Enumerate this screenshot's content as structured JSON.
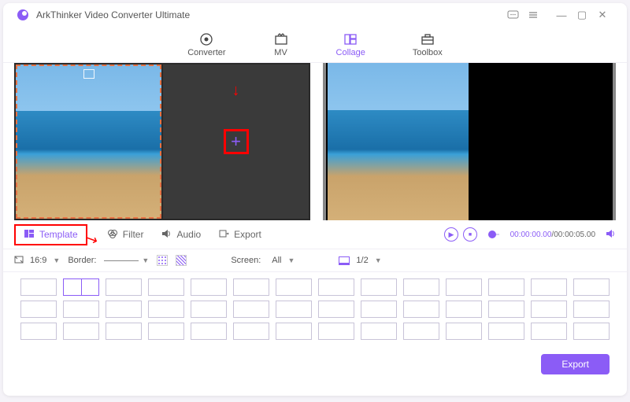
{
  "title": "ArkThinker Video Converter Ultimate",
  "nav": {
    "converter": "Converter",
    "mv": "MV",
    "collage": "Collage",
    "toolbox": "Toolbox"
  },
  "tabs": {
    "template": "Template",
    "filter": "Filter",
    "audio": "Audio",
    "export": "Export"
  },
  "options": {
    "aspect": "16:9",
    "border_label": "Border:",
    "screen_label": "Screen:",
    "screen_value": "All",
    "split_value": "1/2"
  },
  "player": {
    "current": "00:00:00.00",
    "duration": "00:00:05.00",
    "sep": "/"
  },
  "footer": {
    "export": "Export"
  }
}
